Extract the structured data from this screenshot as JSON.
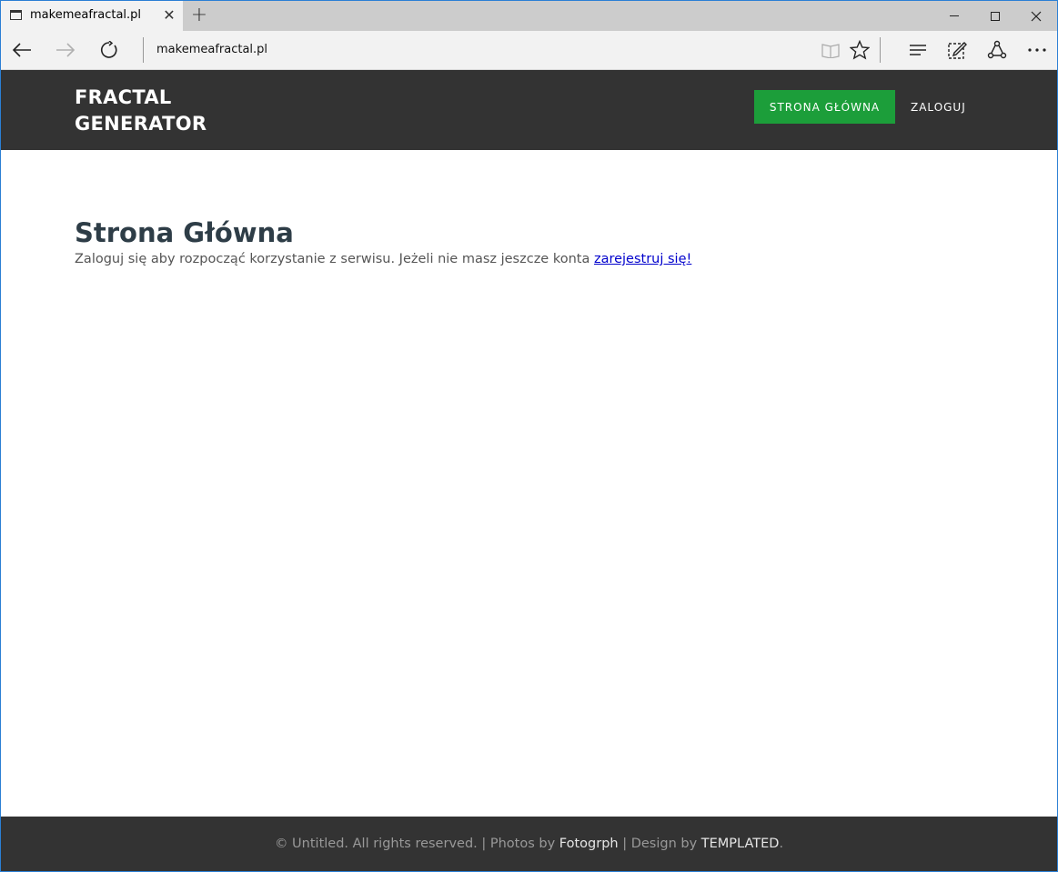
{
  "browser": {
    "tab_title": "makemeafractal.pl",
    "tab_close": "✕",
    "new_tab": "+",
    "url": "makemeafractal.pl"
  },
  "header": {
    "logo_line1": "FRACTAL",
    "logo_line2": "GENERATOR",
    "nav": {
      "home": "STRONA GŁÓWNA",
      "login": "ZALOGUJ"
    }
  },
  "main": {
    "title": "Strona Główna",
    "text": "Zaloguj się aby rozpocząć korzystanie z serwisu. Jeżeli nie masz jeszcze konta ",
    "register_link": "zarejestruj się!"
  },
  "footer": {
    "prefix": "© Untitled. All rights reserved. | Photos by ",
    "photos_link": "Fotogrph",
    "middle": " | Design by ",
    "design_link": "TEMPLATED",
    "suffix": "."
  },
  "colors": {
    "header_bg": "#333333",
    "nav_active": "#1c9e3a",
    "title": "#2e3d47",
    "link": "#0000cc"
  }
}
